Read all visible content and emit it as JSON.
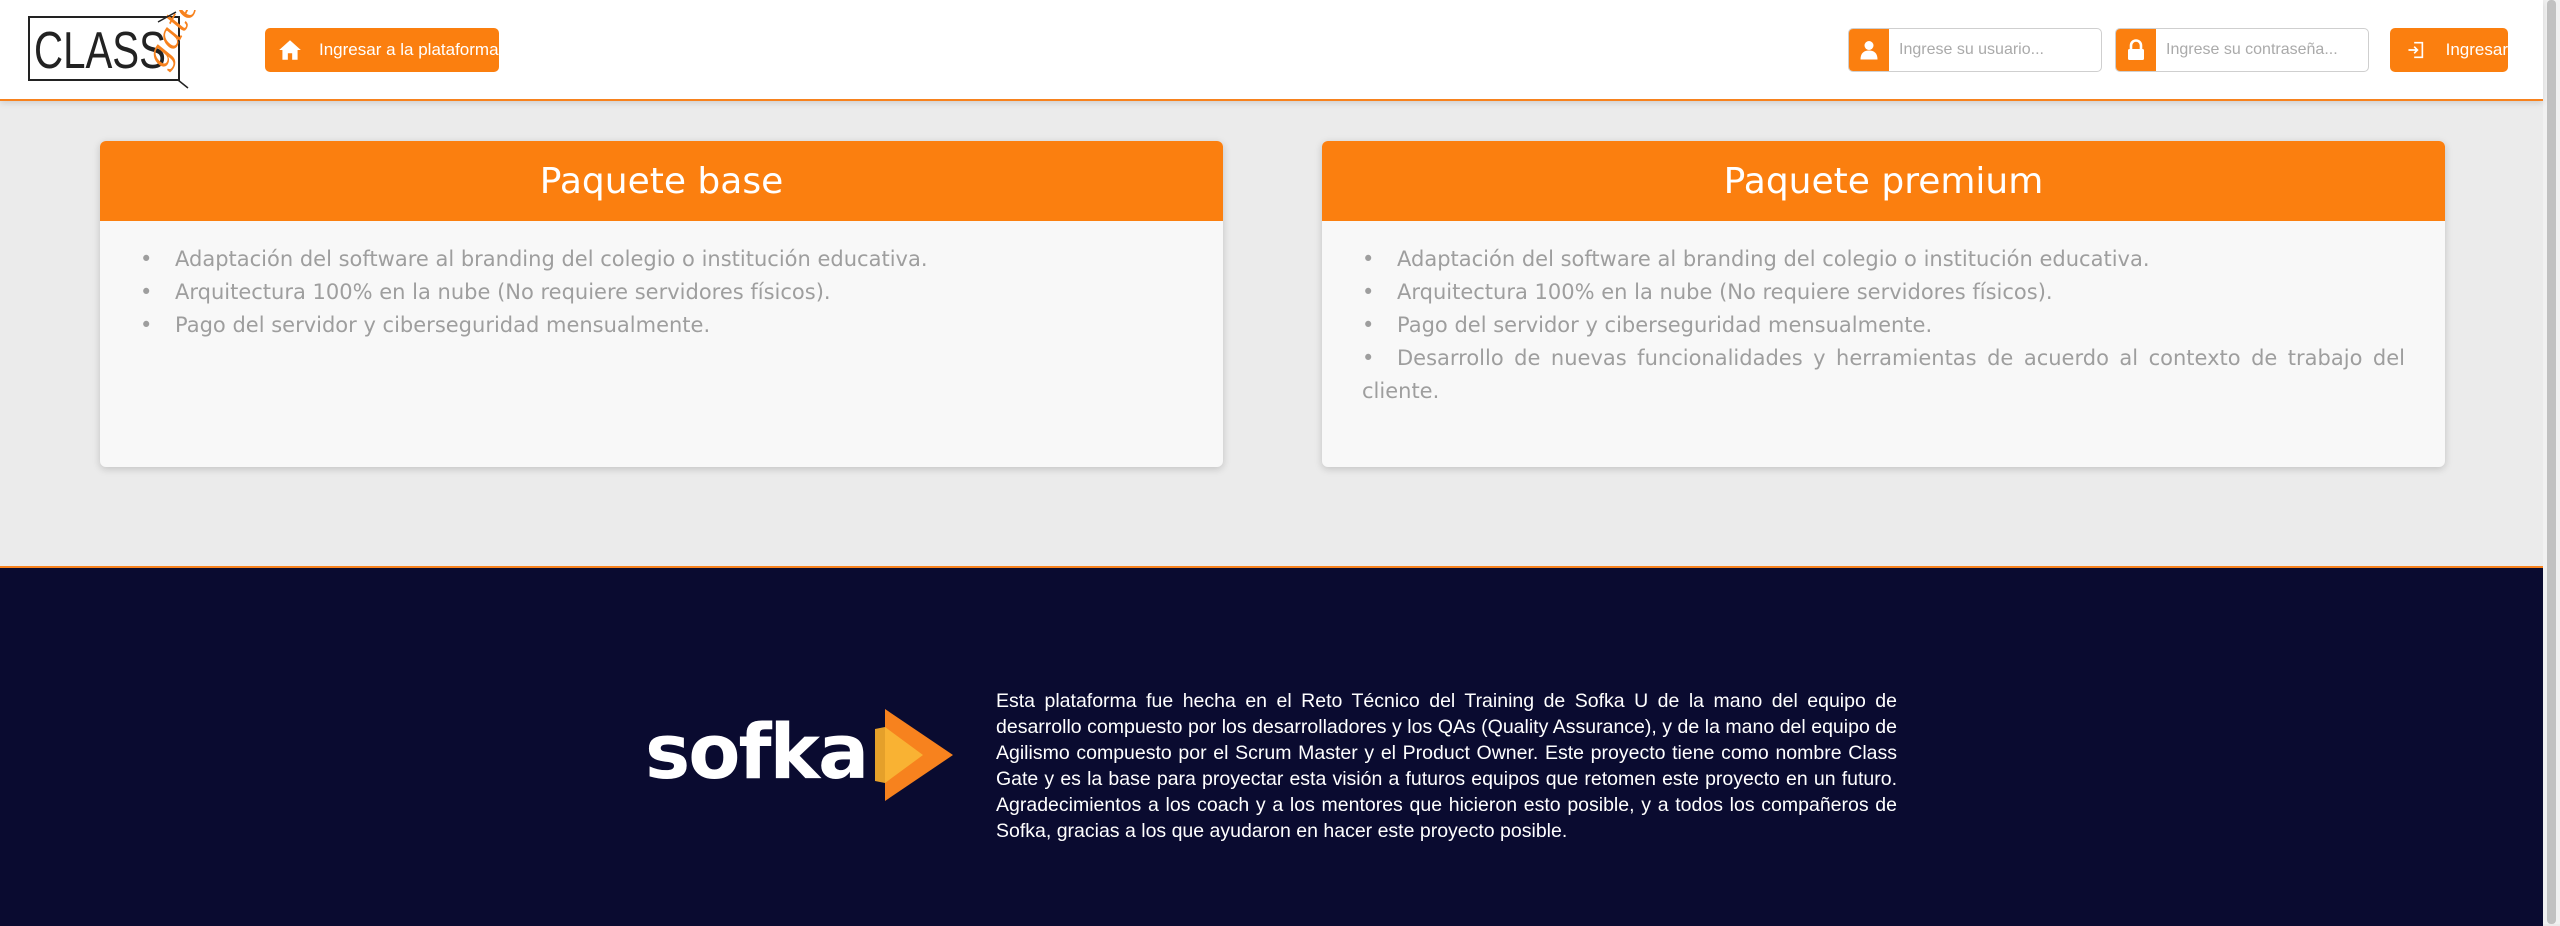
{
  "header": {
    "logo": {
      "text_main": "CLASS",
      "text_accent": "gate"
    },
    "platform_button_label": "Ingresar a la plataforma",
    "username_placeholder": "Ingrese su usuario...",
    "password_placeholder": "Ingrese su contraseña...",
    "login_button_label": "Ingresar"
  },
  "cards": [
    {
      "title": "Paquete base",
      "items": [
        "Adaptación del software al branding del colegio o institución educativa.",
        "Arquitectura 100% en la nube (No requiere servidores físicos).",
        "Pago del servidor y ciberseguridad mensualmente."
      ]
    },
    {
      "title": "Paquete premium",
      "items": [
        "Adaptación del software al branding del colegio o institución educativa.",
        "Arquitectura 100% en la nube (No requiere servidores físicos).",
        "Pago del servidor y ciberseguridad mensualmente.",
        "Desarrollo de nuevas funcionalidades y herramientas de acuerdo al contexto de trabajo del cliente."
      ]
    }
  ],
  "footer": {
    "logo_text": "sofka",
    "description": "Esta plataforma fue hecha en el Reto Técnico del Training de Sofka U de la mano del equipo de desarrollo compuesto por los desarrolladores y los QAs (Quality Assurance), y de la mano del equipo de Agilismo compuesto por el Scrum Master y el Product Owner. Este proyecto tiene como nombre Class Gate y es la base para proyectar esta visión a futuros equipos que retomen este proyecto en un futuro. Agradecimientos a los coach y a los mentores que hicieron esto posible, y a todos los compañeros de Sofka, gracias a los que ayudaron en hacer este proyecto posible."
  },
  "colors": {
    "accent": "#fb7f0f",
    "footer_bg": "#0a0b30",
    "page_bg": "#ebebeb",
    "list_text": "#9e9e9e"
  },
  "icons": {
    "platform_button": "home-icon",
    "username_field": "user-icon",
    "password_field": "lock-icon",
    "login_button": "sign-in-icon"
  }
}
